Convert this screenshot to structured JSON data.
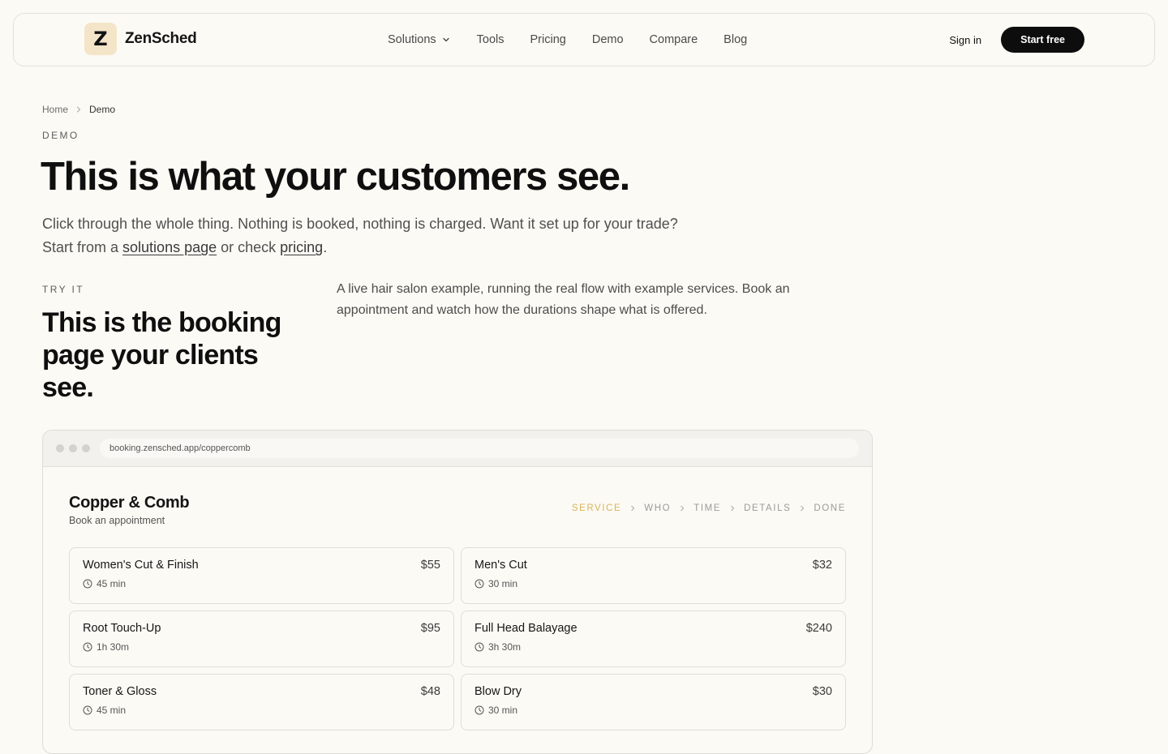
{
  "header": {
    "logo_letter": "Z",
    "brand": "ZenSched",
    "nav": {
      "solutions": "Solutions",
      "tools": "Tools",
      "pricing": "Pricing",
      "demo": "Demo",
      "compare": "Compare",
      "blog": "Blog"
    },
    "sign_in": "Sign in",
    "start_free": "Start free"
  },
  "breadcrumb": {
    "home": "Home",
    "current": "Demo"
  },
  "hero": {
    "eyebrow": "DEMO",
    "title": "This is what your customers see.",
    "sub_1": "Click through the whole thing. Nothing is booked, nothing is charged. Want it set up for your trade? Start from a ",
    "link_solutions": "solutions page",
    "sub_2": " or check ",
    "link_pricing": "pricing",
    "sub_3": "."
  },
  "try_it": {
    "eyebrow": "TRY IT",
    "title": "This is the booking page your clients see.",
    "description": "A live hair salon example, running the real flow with example services. Book an appointment and watch how the durations shape what is offered."
  },
  "booking": {
    "url": "booking.zensched.app/coppercomb",
    "business_name": "Copper & Comb",
    "subtitle": "Book an appointment",
    "steps": [
      "SERVICE",
      "WHO",
      "TIME",
      "DETAILS",
      "DONE"
    ],
    "active_step": "SERVICE",
    "services": [
      {
        "name": "Women's Cut & Finish",
        "price": "$55",
        "duration": "45 min"
      },
      {
        "name": "Men's Cut",
        "price": "$32",
        "duration": "30 min"
      },
      {
        "name": "Root Touch-Up",
        "price": "$95",
        "duration": "1h 30m"
      },
      {
        "name": "Full Head Balayage",
        "price": "$240",
        "duration": "3h 30m"
      },
      {
        "name": "Toner & Gloss",
        "price": "$48",
        "duration": "45 min"
      },
      {
        "name": "Blow Dry",
        "price": "$30",
        "duration": "30 min"
      }
    ]
  },
  "colors": {
    "background": "#fcfaf4",
    "accent_step": "#d9b45a",
    "button": "#0d0d0d",
    "logo_bg": "#f4e5c8"
  },
  "icons": [
    "chevron-down-icon",
    "chevron-right-icon",
    "clock-icon"
  ]
}
